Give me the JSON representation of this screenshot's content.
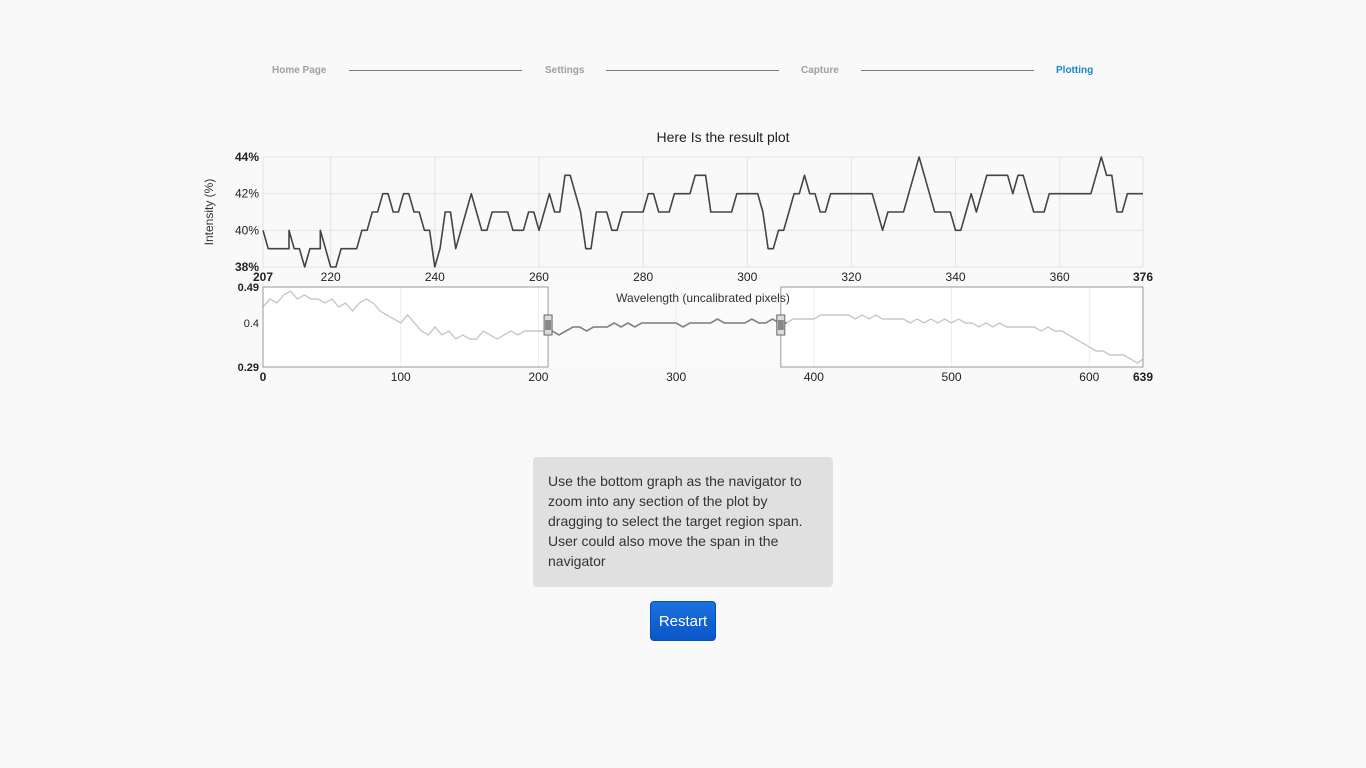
{
  "wizard": {
    "steps": [
      {
        "label": "Home Page",
        "active": false
      },
      {
        "label": "Settings",
        "active": false
      },
      {
        "label": "Capture",
        "active": false
      },
      {
        "label": "Plotting",
        "active": true
      }
    ]
  },
  "colors": {
    "active_step": "#1a86d0",
    "inactive_step": "#a0a0a0",
    "line": "#444444",
    "navigator_dim": "#c8c8c8",
    "button": "#0a5ad0"
  },
  "chart_data": [
    {
      "type": "line",
      "title": "Here Is the result plot",
      "xlabel": "Wavelength (uncalibrated pixels)",
      "ylabel": "Intensity (%)",
      "xlim": [
        207,
        376
      ],
      "ylim": [
        38,
        44
      ],
      "xticks": [
        "207",
        "220",
        "240",
        "260",
        "280",
        "300",
        "320",
        "340",
        "360",
        "376"
      ],
      "xtick_values": [
        207,
        220,
        240,
        260,
        280,
        300,
        320,
        340,
        360,
        376
      ],
      "yticks": [
        "44%",
        "42%",
        "40%",
        "38%"
      ],
      "ytick_values": [
        44,
        42,
        40,
        38
      ],
      "grid": true,
      "points": [
        [
          207,
          40
        ],
        [
          208,
          39
        ],
        [
          212,
          39
        ],
        [
          212,
          39
        ],
        [
          212,
          39
        ],
        [
          212,
          39
        ],
        [
          212,
          40
        ],
        [
          213,
          39
        ],
        [
          214,
          39
        ],
        [
          215,
          38
        ],
        [
          215,
          38
        ],
        [
          216,
          39
        ],
        [
          218,
          39
        ],
        [
          218,
          40
        ],
        [
          220,
          38
        ],
        [
          221,
          38
        ],
        [
          221,
          38
        ],
        [
          222,
          39
        ],
        [
          225,
          39
        ],
        [
          226,
          40
        ],
        [
          227,
          40
        ],
        [
          228,
          41
        ],
        [
          229,
          41
        ],
        [
          230,
          42
        ],
        [
          231,
          42
        ],
        [
          232,
          41
        ],
        [
          233,
          41
        ],
        [
          234,
          42
        ],
        [
          235,
          42
        ],
        [
          236,
          41
        ],
        [
          237,
          41
        ],
        [
          238,
          40
        ],
        [
          239,
          40
        ],
        [
          240,
          38
        ],
        [
          241,
          39
        ],
        [
          242,
          41
        ],
        [
          243,
          41
        ],
        [
          244,
          39
        ],
        [
          245,
          40
        ],
        [
          246,
          41
        ],
        [
          247,
          42
        ],
        [
          248,
          41
        ],
        [
          249,
          40
        ],
        [
          250,
          40
        ],
        [
          251,
          41
        ],
        [
          252,
          41
        ],
        [
          254,
          41
        ],
        [
          255,
          40
        ],
        [
          257,
          40
        ],
        [
          258,
          41
        ],
        [
          259,
          41
        ],
        [
          260,
          40
        ],
        [
          261,
          41
        ],
        [
          262,
          42
        ],
        [
          263,
          41
        ],
        [
          264,
          41
        ],
        [
          265,
          43
        ],
        [
          266,
          43
        ],
        [
          268,
          41
        ],
        [
          269,
          39
        ],
        [
          270,
          39
        ],
        [
          271,
          41
        ],
        [
          272,
          41
        ],
        [
          273,
          41
        ],
        [
          274,
          40
        ],
        [
          275,
          40
        ],
        [
          276,
          41
        ],
        [
          277,
          41
        ],
        [
          280,
          41
        ],
        [
          281,
          42
        ],
        [
          282,
          42
        ],
        [
          283,
          41
        ],
        [
          285,
          41
        ],
        [
          286,
          42
        ],
        [
          289,
          42
        ],
        [
          290,
          43
        ],
        [
          292,
          43
        ],
        [
          293,
          41
        ],
        [
          294,
          41
        ],
        [
          297,
          41
        ],
        [
          298,
          42
        ],
        [
          299,
          42
        ],
        [
          302,
          42
        ],
        [
          303,
          41
        ],
        [
          304,
          39
        ],
        [
          305,
          39
        ],
        [
          306,
          40
        ],
        [
          307,
          40
        ],
        [
          308,
          41
        ],
        [
          309,
          42
        ],
        [
          310,
          42
        ],
        [
          311,
          43
        ],
        [
          312,
          42
        ],
        [
          313,
          42
        ],
        [
          314,
          41
        ],
        [
          315,
          41
        ],
        [
          316,
          42
        ],
        [
          324,
          42
        ],
        [
          325,
          41
        ],
        [
          326,
          40
        ],
        [
          327,
          41
        ],
        [
          328,
          41
        ],
        [
          329,
          41
        ],
        [
          330,
          41
        ],
        [
          331,
          42
        ],
        [
          332,
          43
        ],
        [
          333,
          44
        ],
        [
          334,
          43
        ],
        [
          335,
          42
        ],
        [
          336,
          41
        ],
        [
          337,
          41
        ],
        [
          338,
          41
        ],
        [
          339,
          41
        ],
        [
          340,
          40
        ],
        [
          341,
          40
        ],
        [
          342,
          41
        ],
        [
          343,
          42
        ],
        [
          344,
          41
        ],
        [
          345,
          42
        ],
        [
          346,
          43
        ],
        [
          347,
          43
        ],
        [
          348,
          43
        ],
        [
          349,
          43
        ],
        [
          350,
          43
        ],
        [
          351,
          42
        ],
        [
          352,
          43
        ],
        [
          353,
          43
        ],
        [
          354,
          42
        ],
        [
          355,
          41
        ],
        [
          356,
          41
        ],
        [
          357,
          41
        ],
        [
          358,
          42
        ],
        [
          366,
          42
        ],
        [
          367,
          43
        ],
        [
          368,
          44
        ],
        [
          369,
          43
        ],
        [
          370,
          43
        ],
        [
          371,
          41
        ],
        [
          372,
          41
        ],
        [
          373,
          42
        ],
        [
          374,
          42
        ],
        [
          375,
          42
        ],
        [
          376,
          42
        ]
      ]
    },
    {
      "type": "line",
      "xlim": [
        0,
        639
      ],
      "ylim": [
        0.29,
        0.49
      ],
      "xticks": [
        "0",
        "100",
        "200",
        "300",
        "400",
        "500",
        "600",
        "639"
      ],
      "xtick_values": [
        0,
        100,
        200,
        300,
        400,
        500,
        600,
        639
      ],
      "yticks": [
        "0.49",
        "0.4",
        "0.29"
      ],
      "ytick_values": [
        0.49,
        0.4,
        0.29
      ],
      "selected_range": [
        207,
        376
      ],
      "points": [
        [
          0,
          0.44
        ],
        [
          5,
          0.46
        ],
        [
          10,
          0.45
        ],
        [
          15,
          0.47
        ],
        [
          20,
          0.48
        ],
        [
          25,
          0.46
        ],
        [
          30,
          0.47
        ],
        [
          35,
          0.46
        ],
        [
          40,
          0.46
        ],
        [
          45,
          0.45
        ],
        [
          50,
          0.46
        ],
        [
          55,
          0.44
        ],
        [
          60,
          0.45
        ],
        [
          65,
          0.43
        ],
        [
          70,
          0.45
        ],
        [
          75,
          0.46
        ],
        [
          80,
          0.45
        ],
        [
          85,
          0.43
        ],
        [
          90,
          0.42
        ],
        [
          95,
          0.41
        ],
        [
          100,
          0.4
        ],
        [
          105,
          0.42
        ],
        [
          110,
          0.4
        ],
        [
          115,
          0.38
        ],
        [
          120,
          0.37
        ],
        [
          125,
          0.39
        ],
        [
          130,
          0.37
        ],
        [
          135,
          0.38
        ],
        [
          140,
          0.36
        ],
        [
          145,
          0.37
        ],
        [
          150,
          0.36
        ],
        [
          155,
          0.36
        ],
        [
          160,
          0.38
        ],
        [
          165,
          0.37
        ],
        [
          170,
          0.36
        ],
        [
          175,
          0.37
        ],
        [
          180,
          0.38
        ],
        [
          185,
          0.37
        ],
        [
          190,
          0.38
        ],
        [
          195,
          0.38
        ],
        [
          200,
          0.38
        ],
        [
          205,
          0.38
        ],
        [
          210,
          0.38
        ],
        [
          215,
          0.37
        ],
        [
          220,
          0.38
        ],
        [
          225,
          0.39
        ],
        [
          230,
          0.39
        ],
        [
          235,
          0.38
        ],
        [
          240,
          0.39
        ],
        [
          245,
          0.39
        ],
        [
          250,
          0.39
        ],
        [
          255,
          0.4
        ],
        [
          260,
          0.39
        ],
        [
          265,
          0.4
        ],
        [
          270,
          0.39
        ],
        [
          275,
          0.4
        ],
        [
          280,
          0.4
        ],
        [
          285,
          0.4
        ],
        [
          290,
          0.4
        ],
        [
          295,
          0.4
        ],
        [
          300,
          0.4
        ],
        [
          305,
          0.39
        ],
        [
          310,
          0.4
        ],
        [
          315,
          0.4
        ],
        [
          320,
          0.4
        ],
        [
          325,
          0.4
        ],
        [
          330,
          0.41
        ],
        [
          335,
          0.4
        ],
        [
          340,
          0.4
        ],
        [
          345,
          0.4
        ],
        [
          350,
          0.4
        ],
        [
          355,
          0.41
        ],
        [
          360,
          0.4
        ],
        [
          365,
          0.4
        ],
        [
          370,
          0.41
        ],
        [
          375,
          0.4
        ],
        [
          380,
          0.4
        ],
        [
          385,
          0.41
        ],
        [
          390,
          0.41
        ],
        [
          395,
          0.41
        ],
        [
          400,
          0.41
        ],
        [
          405,
          0.42
        ],
        [
          410,
          0.42
        ],
        [
          415,
          0.42
        ],
        [
          420,
          0.42
        ],
        [
          425,
          0.42
        ],
        [
          430,
          0.41
        ],
        [
          435,
          0.42
        ],
        [
          440,
          0.41
        ],
        [
          445,
          0.42
        ],
        [
          450,
          0.41
        ],
        [
          455,
          0.41
        ],
        [
          460,
          0.41
        ],
        [
          465,
          0.41
        ],
        [
          470,
          0.4
        ],
        [
          475,
          0.41
        ],
        [
          480,
          0.4
        ],
        [
          485,
          0.41
        ],
        [
          490,
          0.4
        ],
        [
          495,
          0.41
        ],
        [
          500,
          0.4
        ],
        [
          505,
          0.41
        ],
        [
          510,
          0.4
        ],
        [
          515,
          0.4
        ],
        [
          520,
          0.39
        ],
        [
          525,
          0.4
        ],
        [
          530,
          0.39
        ],
        [
          535,
          0.4
        ],
        [
          540,
          0.39
        ],
        [
          545,
          0.39
        ],
        [
          550,
          0.39
        ],
        [
          555,
          0.39
        ],
        [
          560,
          0.39
        ],
        [
          565,
          0.38
        ],
        [
          570,
          0.39
        ],
        [
          575,
          0.38
        ],
        [
          580,
          0.38
        ],
        [
          585,
          0.37
        ],
        [
          590,
          0.36
        ],
        [
          595,
          0.35
        ],
        [
          600,
          0.34
        ],
        [
          605,
          0.33
        ],
        [
          610,
          0.33
        ],
        [
          615,
          0.32
        ],
        [
          620,
          0.32
        ],
        [
          625,
          0.32
        ],
        [
          630,
          0.31
        ],
        [
          635,
          0.3
        ],
        [
          639,
          0.31
        ]
      ]
    }
  ],
  "info": {
    "text": "Use the bottom graph as the navigator to zoom into any section of the plot by dragging to select the target region span. User could also move the span in the navigator"
  },
  "restart_label": "Restart"
}
